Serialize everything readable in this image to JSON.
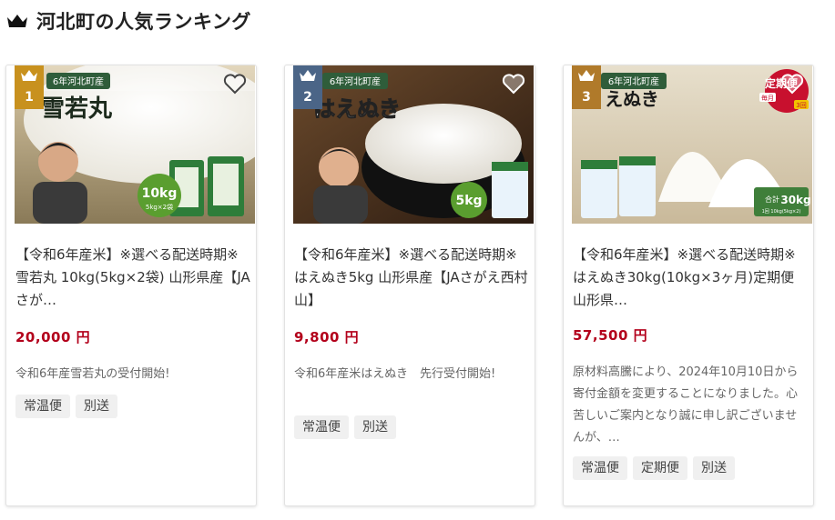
{
  "section": {
    "title": "河北町の人気ランキング",
    "icon": "crown-icon"
  },
  "colors": {
    "price": "#b3001b",
    "rank1": "#c8911e",
    "rank2": "#4b6587",
    "rank3": "#b07a2a"
  },
  "cards": [
    {
      "rank": "1",
      "image_banner": "6年河北町産",
      "image_text": "雪若丸",
      "image_badge": "10kg",
      "image_badge_sub": "5kg×2袋",
      "title": "【令和6年産米】※選べる配送時期※ 雪若丸 10kg(5kg×2袋) 山形県産【JAさが…",
      "price": "20,000 円",
      "description": "令和6年産雪若丸の受付開始!",
      "tags": [
        "常温便",
        "別送"
      ]
    },
    {
      "rank": "2",
      "image_banner": "6年河北町産",
      "image_text": "はえぬき",
      "image_badge": "5kg",
      "title": "【令和6年産米】※選べる配送時期※ はえぬき5kg 山形県産【JAさがえ西村山】",
      "price": "9,800 円",
      "description": "令和6年産米はえぬき　先行受付開始!",
      "tags": [
        "常温便",
        "別送"
      ]
    },
    {
      "rank": "3",
      "image_banner": "6年河北町産",
      "image_text": "えぬき",
      "image_badge_pre": "合計",
      "image_badge": "30kg",
      "image_badge_sub": "1回 10kg(5kg×2)",
      "image_corner": "定期便",
      "image_corner_sub": "毎月",
      "image_corner_count": "3回",
      "title": "【令和6年産米】※選べる配送時期※ はえぬき30kg(10kg×3ヶ月)定期便 山形県…",
      "price": "57,500 円",
      "description": "原材料高騰により、2024年10月10日から寄付金額を変更することになりました。心苦しいご案内となり誠に申し訳ございませんが、…",
      "tags": [
        "常温便",
        "定期便",
        "別送"
      ]
    }
  ]
}
